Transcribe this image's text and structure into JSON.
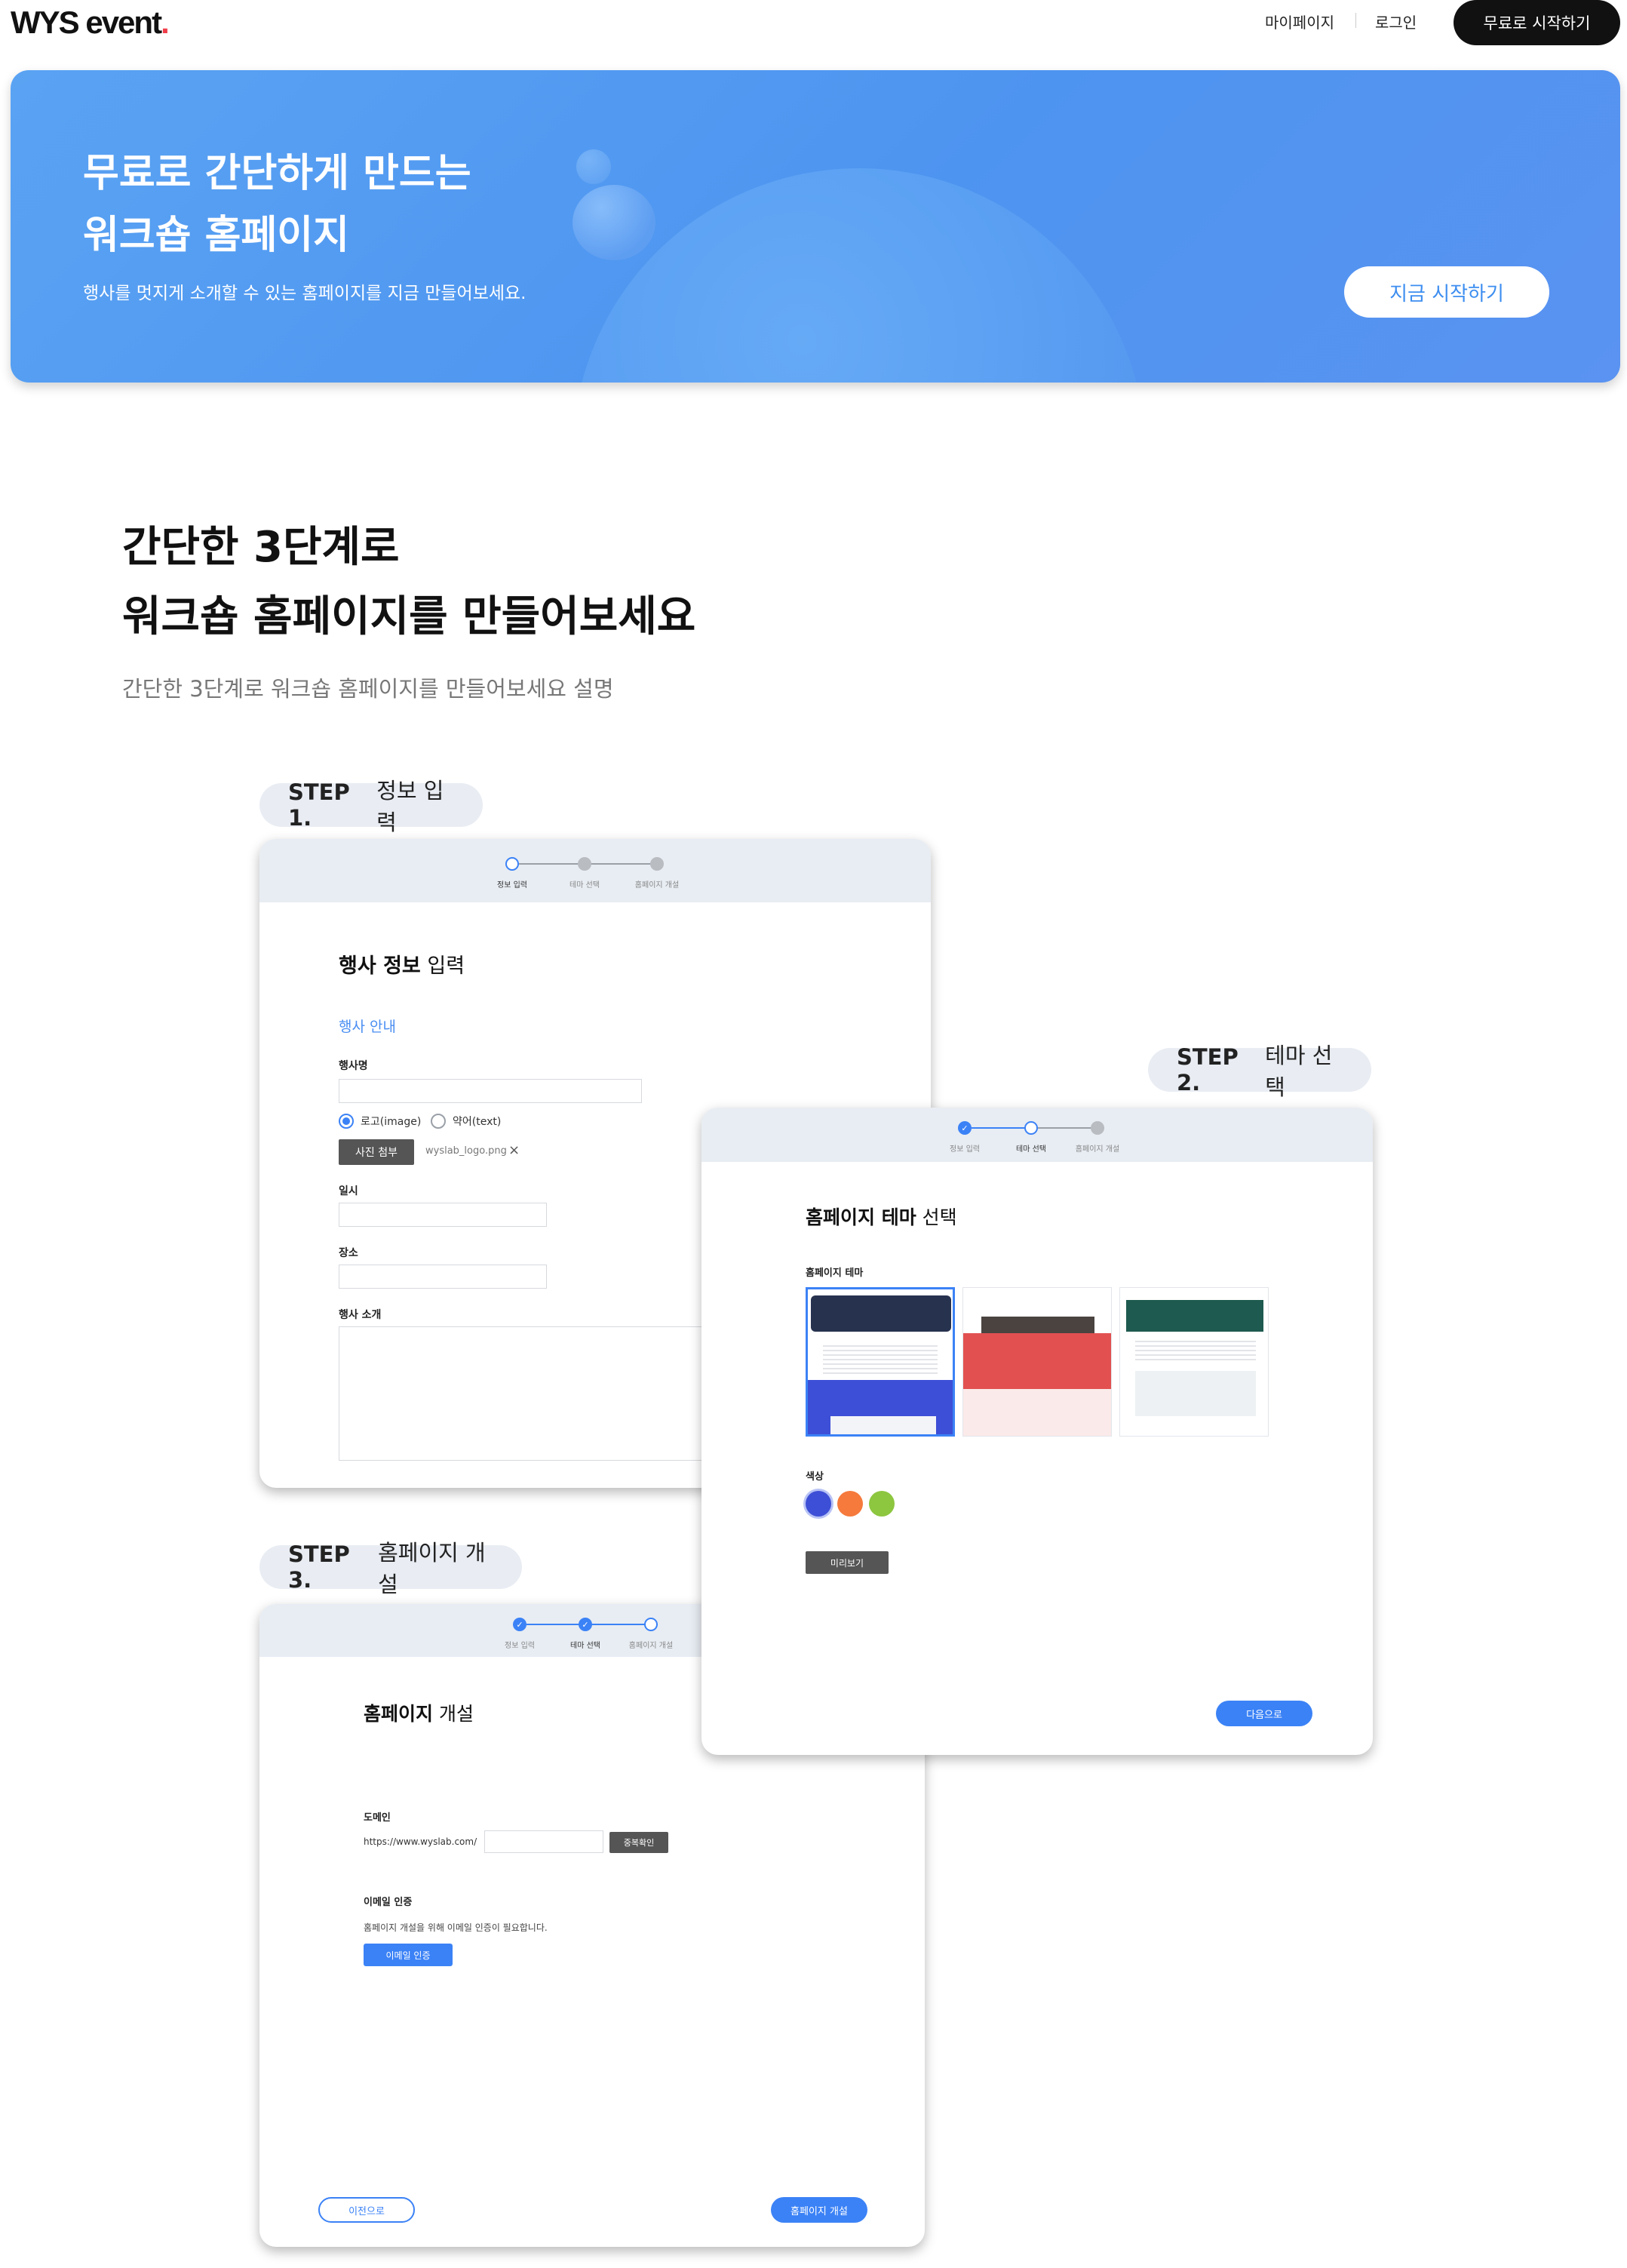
{
  "header": {
    "logo_main": "WYS event",
    "logo_dot": ".",
    "nav_mypage": "마이페이지",
    "nav_login": "로그인",
    "cta": "무료로 시작하기"
  },
  "hero": {
    "title_line1": "무료로 간단하게 만드는",
    "title_line2": "워크숍 홈페이지",
    "subtitle": "행사를 멋지게 소개할 수 있는 홈페이지를 지금 만들어보세요.",
    "button": "지금 시작하기"
  },
  "section": {
    "title_line1": "간단한 3단계로",
    "title_line2": "워크숍 홈페이지를 만들어보세요",
    "description": "간단한 3단계로 워크숍 홈페이지를 만들어보세요 설명"
  },
  "progress_labels": [
    "정보 입력",
    "테마 선택",
    "홈페이지 개설"
  ],
  "step1": {
    "pill_bold": "STEP 1.",
    "pill_text": "정보 입력",
    "title_bold": "행사 정보",
    "title_rest": " 입력",
    "section_label": "행사 안내",
    "event_name_label": "행사명",
    "radio_logo": "로고(image)",
    "radio_text": "약어(text)",
    "attach_button": "사진 첨부",
    "attached_file": "wyslab_logo.png",
    "date_label": "일시",
    "place_label": "장소",
    "intro_label": "행사 소개"
  },
  "step2": {
    "pill_bold": "STEP 2.",
    "pill_text": "테마 선택",
    "title_bold": "홈페이지 테마",
    "title_rest": " 선택",
    "theme_label": "홈페이지 테마",
    "color_label": "색상",
    "colors": [
      "#3d4fd6",
      "#f57a3c",
      "#8dc63f"
    ],
    "preview_button": "미리보기",
    "next_button": "다음으로"
  },
  "step3": {
    "pill_bold": "STEP 3.",
    "pill_text": "홈페이지 개설",
    "title_bold": "홈페이지",
    "title_rest": " 개설",
    "domain_label": "도메인",
    "domain_prefix": "https://www.wyslab.com/",
    "dup_check_button": "중복확인",
    "email_label": "이메일 인증",
    "email_desc": "홈페이지 개설을 위해 이메일 인증이 필요합니다.",
    "email_button": "이메일 인증",
    "prev_button": "이전으로",
    "open_button": "홈페이지 개설"
  },
  "colors": {
    "accent": "#3b82f6",
    "hero_bg": "#4d94f0",
    "dark": "#111111"
  }
}
